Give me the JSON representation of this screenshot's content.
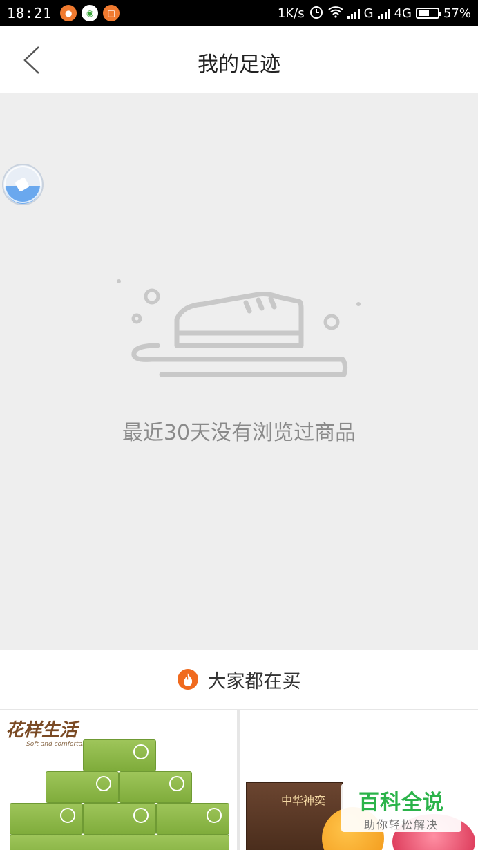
{
  "status_bar": {
    "time": "18:21",
    "net_speed": "1K/s",
    "network_g": "G",
    "network_4g": "4G",
    "battery": "57%",
    "battery_level": 0.57
  },
  "header": {
    "title": "我的足迹"
  },
  "empty_state": {
    "message": "最近30天没有浏览过商品"
  },
  "recommend": {
    "title": "大家都在买",
    "products": [
      {
        "brand": "花样生活",
        "brand_sub": "Soft and comfortable"
      },
      {
        "box_label": "中华神奕"
      }
    ]
  },
  "watermark": {
    "title": "百科全说",
    "subtitle": "助你轻松解决"
  },
  "colors": {
    "accent": "#f06a1e",
    "background": "#eeeeee",
    "watermark_green": "#2bb34a"
  }
}
